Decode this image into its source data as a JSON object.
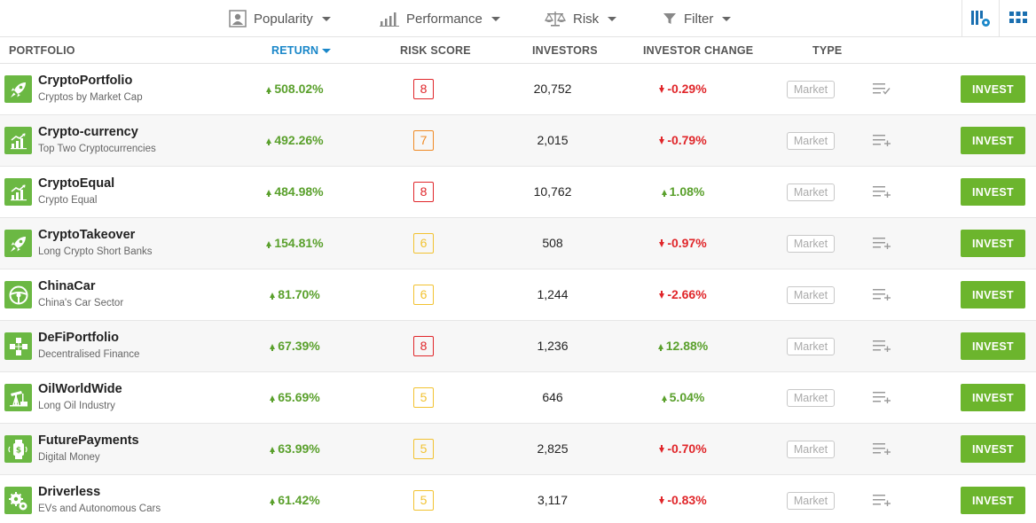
{
  "toolbar": {
    "filters": [
      {
        "label": "Popularity",
        "icon": "person-icon"
      },
      {
        "label": "Performance",
        "icon": "bar-chart-icon"
      },
      {
        "label": "Risk",
        "icon": "scale-icon"
      },
      {
        "label": "Filter",
        "icon": "funnel-icon"
      }
    ],
    "views": [
      {
        "icon": "column-settings-icon"
      },
      {
        "icon": "grid-view-icon"
      }
    ]
  },
  "columns": {
    "portfolio": "PORTFOLIO",
    "return": "RETURN",
    "risk_score": "RISK SCORE",
    "investors": "INVESTORS",
    "investor_change": "INVESTOR CHANGE",
    "type": "TYPE"
  },
  "colors": {
    "accent": "#1a87c9",
    "invest_button": "#6cb52d",
    "positive": "#5aa02c",
    "negative": "#e0262a",
    "risk_high": "#e0262a",
    "risk_7": "#f08a24",
    "risk_medium": "#f2c230"
  },
  "invest_label": "INVEST",
  "rows": [
    {
      "name": "CryptoPortfolio",
      "subtitle": "Cryptos by Market Cap",
      "icon": "rocket-icon",
      "return": "508.02%",
      "risk": "8",
      "investors": "20,752",
      "change": "-0.29%",
      "change_dir": "neg",
      "type": "Market",
      "watch": "list-check-icon"
    },
    {
      "name": "Crypto-currency",
      "subtitle": "Top Two Cryptocurrencies",
      "icon": "growth-chart-icon",
      "return": "492.26%",
      "risk": "7",
      "investors": "2,015",
      "change": "-0.79%",
      "change_dir": "neg",
      "type": "Market",
      "watch": "list-add-icon"
    },
    {
      "name": "CryptoEqual",
      "subtitle": "Crypto Equal",
      "icon": "growth-chart-icon",
      "return": "484.98%",
      "risk": "8",
      "investors": "10,762",
      "change": "1.08%",
      "change_dir": "pos",
      "type": "Market",
      "watch": "list-add-icon"
    },
    {
      "name": "CryptoTakeover",
      "subtitle": "Long Crypto Short Banks",
      "icon": "rocket-icon",
      "return": "154.81%",
      "risk": "6",
      "investors": "508",
      "change": "-0.97%",
      "change_dir": "neg",
      "type": "Market",
      "watch": "list-add-icon"
    },
    {
      "name": "ChinaCar",
      "subtitle": "China's Car Sector",
      "icon": "steering-wheel-icon",
      "return": "81.70%",
      "risk": "6",
      "investors": "1,244",
      "change": "-2.66%",
      "change_dir": "neg",
      "type": "Market",
      "watch": "list-add-icon"
    },
    {
      "name": "DeFiPortfolio",
      "subtitle": "Decentralised Finance",
      "icon": "network-cubes-icon",
      "return": "67.39%",
      "risk": "8",
      "investors": "1,236",
      "change": "12.88%",
      "change_dir": "pos",
      "type": "Market",
      "watch": "list-add-icon"
    },
    {
      "name": "OilWorldWide",
      "subtitle": "Long Oil Industry",
      "icon": "oil-pump-icon",
      "return": "65.69%",
      "risk": "5",
      "investors": "646",
      "change": "5.04%",
      "change_dir": "pos",
      "type": "Market",
      "watch": "list-add-icon"
    },
    {
      "name": "FuturePayments",
      "subtitle": "Digital Money",
      "icon": "smartwatch-payment-icon",
      "return": "63.99%",
      "risk": "5",
      "investors": "2,825",
      "change": "-0.70%",
      "change_dir": "neg",
      "type": "Market",
      "watch": "list-add-icon"
    },
    {
      "name": "Driverless",
      "subtitle": "EVs and Autonomous Cars",
      "icon": "gear-car-icon",
      "return": "61.42%",
      "risk": "5",
      "investors": "3,117",
      "change": "-0.83%",
      "change_dir": "neg",
      "type": "Market",
      "watch": "list-add-icon"
    }
  ]
}
